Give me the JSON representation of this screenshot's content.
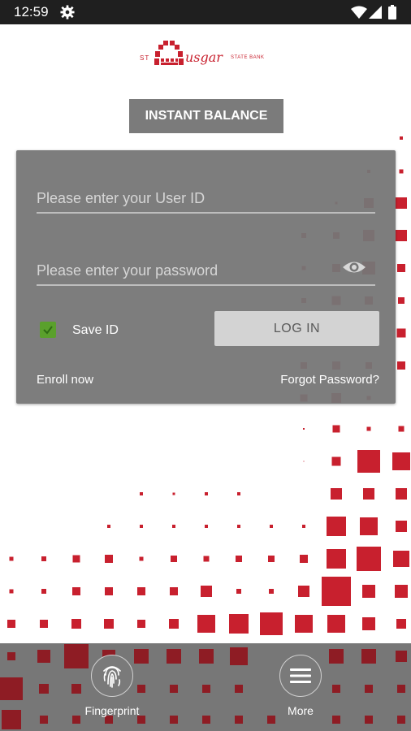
{
  "status_bar": {
    "time": "12:59"
  },
  "logo": {
    "prefix": "ST",
    "name": "usgar",
    "suffix": "STATE BANK"
  },
  "instant_balance": {
    "label": "INSTANT BALANCE"
  },
  "login_form": {
    "userid_placeholder": "Please enter your User ID",
    "password_placeholder": "Please enter your password",
    "save_id_label": "Save ID",
    "save_id_checked": true,
    "login_label": "LOG IN",
    "enroll_label": "Enroll now",
    "forgot_label": "Forgot Password?"
  },
  "bottom_nav": {
    "fingerprint_label": "Fingerprint",
    "more_label": "More"
  },
  "colors": {
    "brand_red": "#c8202e",
    "dark_red": "#8e1c24",
    "card_gray": "#767676",
    "check_green": "#5aa02c"
  }
}
